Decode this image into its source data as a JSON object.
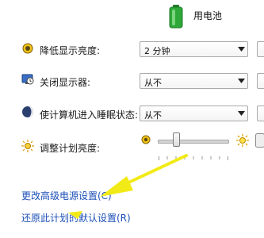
{
  "column_header": {
    "label": "用电池",
    "icon": "battery-icon",
    "battery_color": "#2fa83a"
  },
  "rows": [
    {
      "label": "降低显示亮度:",
      "icon": "dim-display-icon",
      "value": "2 分钟"
    },
    {
      "label": "关闭显示器:",
      "icon": "monitor-off-icon",
      "value": "从不"
    },
    {
      "label": "使计算机进入睡眠状态:",
      "icon": "sleep-moon-icon",
      "value": "从不"
    }
  ],
  "brightness": {
    "label": "调整计划亮度:",
    "icon": "brightness-sun-icon",
    "level_percent": 20
  },
  "links": {
    "advanced": "更改高级电源设置(C)",
    "restore": "还原此计划的默认设置(R)"
  },
  "colors": {
    "link": "#1c4fb8",
    "annotation_arrow": "#f2ea16"
  }
}
